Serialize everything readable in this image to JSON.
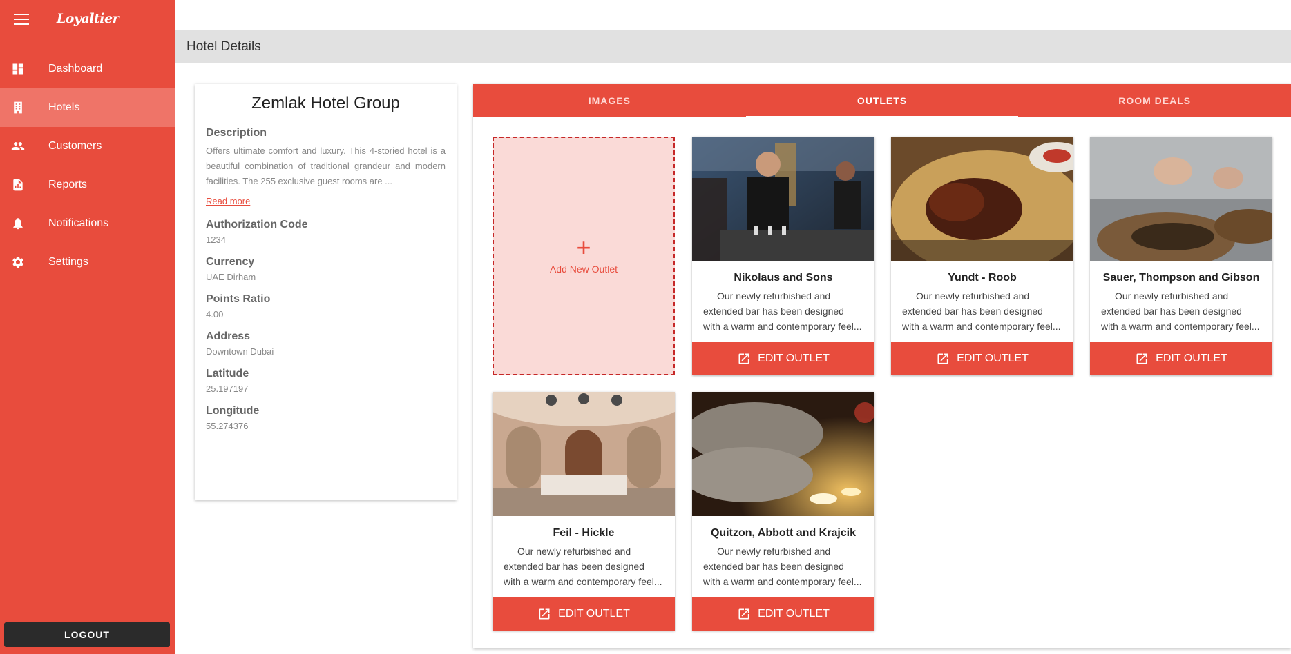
{
  "app": {
    "logo": "Loyaltier"
  },
  "sidebar": {
    "items": [
      {
        "label": "Dashboard",
        "icon": "dashboard-icon"
      },
      {
        "label": "Hotels",
        "icon": "building-icon",
        "active": true
      },
      {
        "label": "Customers",
        "icon": "people-icon"
      },
      {
        "label": "Reports",
        "icon": "report-icon"
      },
      {
        "label": "Notifications",
        "icon": "bell-icon"
      },
      {
        "label": "Settings",
        "icon": "gear-icon"
      }
    ],
    "logout_label": "LOGOUT"
  },
  "header": {
    "title": "Hotel Details"
  },
  "hotel": {
    "name": "Zemlak Hotel Group",
    "description_label": "Description",
    "description": "Offers ultimate comfort and luxury. This 4-storied hotel is a beautiful combination of traditional grandeur and modern facilities. The 255 exclusive guest rooms are ...",
    "read_more": "Read more",
    "fields": [
      {
        "label": "Authorization Code",
        "value": "1234"
      },
      {
        "label": "Currency",
        "value": "UAE Dirham"
      },
      {
        "label": "Points Ratio",
        "value": "4.00"
      },
      {
        "label": "Address",
        "value": "Downtown Dubai"
      },
      {
        "label": "Latitude",
        "value": "25.197197"
      },
      {
        "label": "Longitude",
        "value": "55.274376"
      }
    ]
  },
  "tabs": [
    {
      "label": "IMAGES"
    },
    {
      "label": "OUTLETS",
      "active": true
    },
    {
      "label": "ROOM DEALS"
    }
  ],
  "add_outlet_label": "Add New Outlet",
  "edit_label": "EDIT OUTLET",
  "outlets": [
    {
      "name": "Nikolaus and Sons",
      "desc": "Our newly refurbished and extended bar has been designed with a warm and contemporary feel..."
    },
    {
      "name": "Yundt - Roob",
      "desc": "Our newly refurbished and extended bar has been designed with a warm and contemporary feel..."
    },
    {
      "name": "Sauer, Thompson and Gibson",
      "desc": "Our newly refurbished and extended bar has been designed with a warm and contemporary feel..."
    },
    {
      "name": "Feil - Hickle",
      "desc": "Our newly refurbished and extended bar has been designed with a warm and contemporary feel..."
    },
    {
      "name": "Quitzon, Abbott and Krajcik",
      "desc": "Our newly refurbished and extended bar has been designed with a warm and contemporary feel..."
    }
  ],
  "colors": {
    "accent": "#e84c3d",
    "accent_light": "#fadad7",
    "dark": "#2b2b2b"
  }
}
